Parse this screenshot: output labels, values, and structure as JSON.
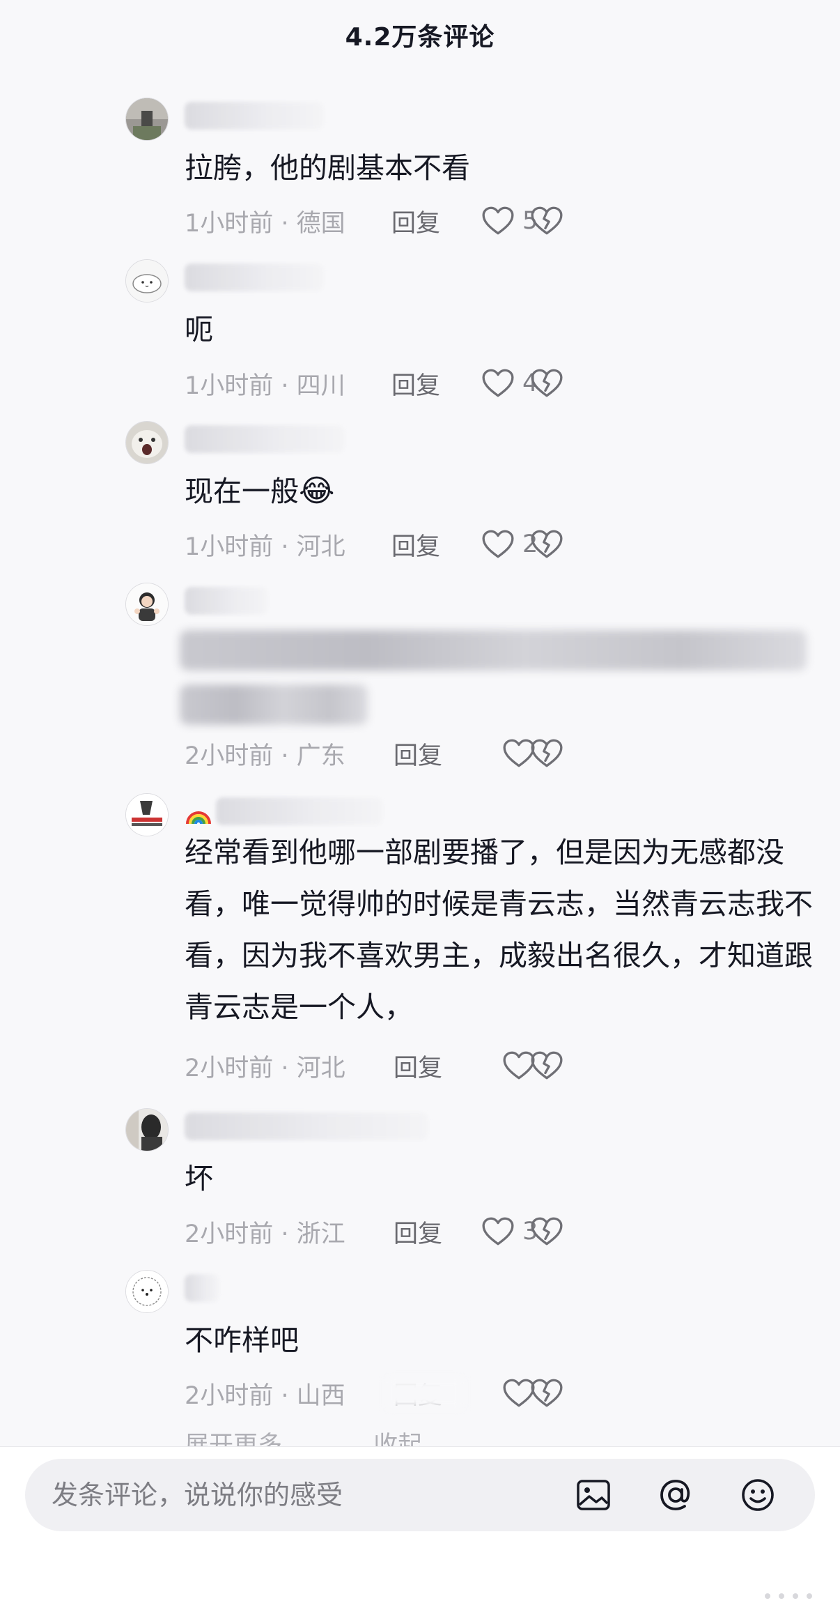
{
  "header": {
    "title": "4.2万条评论"
  },
  "comments": [
    {
      "content": "拉胯，他的剧基本不看",
      "time": "1小时前 · 德国",
      "reply": "回复",
      "likes": "5"
    },
    {
      "content": "呃",
      "time": "1小时前 · 四川",
      "reply": "回复",
      "likes": "4"
    },
    {
      "content": "现在一般",
      "emoji": "😂",
      "time": "1小时前 · 河北",
      "reply": "回复",
      "likes": "2"
    },
    {
      "content": "",
      "time": "2小时前 · 广东",
      "reply": "回复",
      "likes": ""
    },
    {
      "content": "经常看到他哪一部剧要播了，但是因为无感都没看，唯一觉得帅的时候是青云志，当然青云志我不看，因为我不喜欢男主，成毅出名很久，才知道跟青云志是一个人，",
      "time": "2小时前 · 河北",
      "reply": "回复",
      "likes": ""
    },
    {
      "content": "坏",
      "time": "2小时前 · 浙江",
      "reply": "回复",
      "likes": "3"
    },
    {
      "content": "不咋样吧",
      "time": "2小时前 · 山西",
      "reply": "回复",
      "likes": ""
    }
  ],
  "expand": {
    "more": "展开更多",
    "collapse": "收起"
  },
  "input": {
    "placeholder": "发条评论，说说你的感受"
  },
  "icons": {
    "like": "heart-outline-icon",
    "dislike": "broken-heart-icon",
    "image": "image-icon",
    "mention": "at-icon",
    "emoji": "smiley-icon"
  },
  "colors": {
    "text": "#161823",
    "muted": "#a8a8ae",
    "reply": "#69696f",
    "background": "#f8f8fa",
    "input": "#f0f0f3"
  }
}
